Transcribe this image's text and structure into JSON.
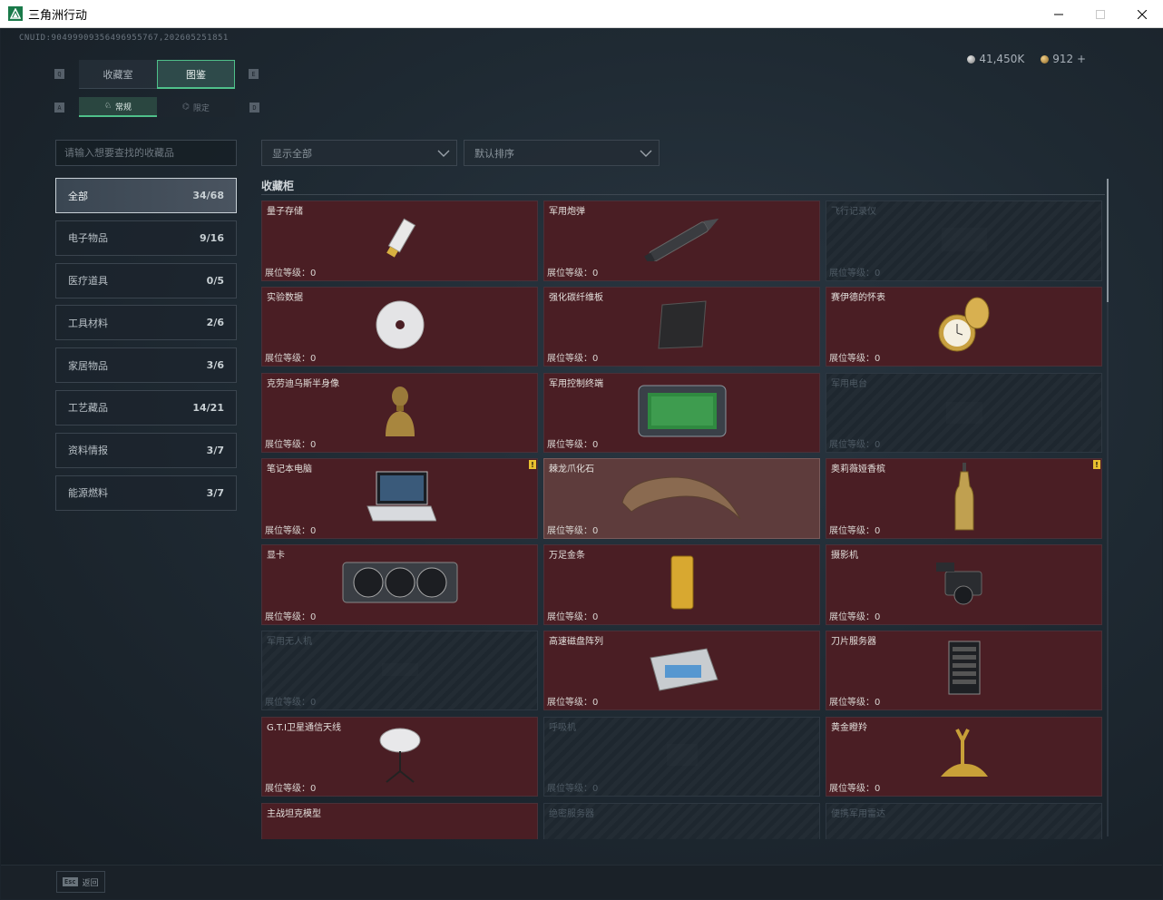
{
  "window": {
    "title": "三角洲行动",
    "controls": [
      "minimize",
      "maximize",
      "close"
    ]
  },
  "header": {
    "uid": "CNUID:9049990935649695576​7,202605251851",
    "currency_silver": "41,450K",
    "currency_gold": "912",
    "add_label": "+"
  },
  "tabs": {
    "main": [
      "收藏室",
      "图鉴"
    ],
    "main_active": 1,
    "sub": [
      "常规",
      "限定"
    ],
    "sub_active": 0,
    "key_q": "Q",
    "key_e": "E",
    "key_a": "A",
    "key_d": "D"
  },
  "search": {
    "placeholder": "请输入想要查找的收藏品"
  },
  "filters": {
    "show": "显示全部",
    "sort": "默认排序"
  },
  "categories": [
    {
      "label": "全部",
      "count": "34/68"
    },
    {
      "label": "电子物品",
      "count": "9/16"
    },
    {
      "label": "医疗道具",
      "count": "0/5"
    },
    {
      "label": "工具材料",
      "count": "2/6"
    },
    {
      "label": "家居物品",
      "count": "3/6"
    },
    {
      "label": "工艺藏品",
      "count": "14/21"
    },
    {
      "label": "资料情报",
      "count": "3/7"
    },
    {
      "label": "能源燃料",
      "count": "3/7"
    }
  ],
  "section_title": "收藏柜",
  "level_label": "展位等级：0",
  "items": [
    {
      "name": "量子存储",
      "state": "owned",
      "icon": "usb-drive-icon"
    },
    {
      "name": "军用炮弹",
      "state": "owned",
      "icon": "shell-icon"
    },
    {
      "name": "飞行记录仪",
      "state": "locked",
      "icon": "flight-recorder-icon"
    },
    {
      "name": "实验数据",
      "state": "owned",
      "icon": "cd-disc-icon"
    },
    {
      "name": "强化碳纤维板",
      "state": "owned",
      "icon": "carbon-plate-icon"
    },
    {
      "name": "赛伊德的怀表",
      "state": "owned",
      "icon": "pocket-watch-icon"
    },
    {
      "name": "克劳迪乌斯半身像",
      "state": "owned",
      "icon": "bust-icon"
    },
    {
      "name": "军用控制终端",
      "state": "owned",
      "icon": "terminal-icon"
    },
    {
      "name": "军用电台",
      "state": "locked",
      "icon": "radio-icon"
    },
    {
      "name": "笔记本电脑",
      "state": "owned",
      "icon": "laptop-icon",
      "warn": true
    },
    {
      "name": "棘龙爪化石",
      "state": "highlight",
      "icon": "claw-fossil-icon"
    },
    {
      "name": "奥莉薇娅香槟",
      "state": "owned",
      "icon": "champagne-icon",
      "warn": true
    },
    {
      "name": "显卡",
      "state": "owned",
      "icon": "gpu-icon"
    },
    {
      "name": "万足金条",
      "state": "owned",
      "icon": "gold-bar-icon"
    },
    {
      "name": "摄影机",
      "state": "owned",
      "icon": "camera-icon"
    },
    {
      "name": "军用无人机",
      "state": "locked",
      "icon": "drone-icon"
    },
    {
      "name": "高速磁盘阵列",
      "state": "owned",
      "icon": "disk-array-icon"
    },
    {
      "name": "刀片服务器",
      "state": "owned",
      "icon": "blade-server-icon"
    },
    {
      "name": "G.T.I卫星通信天线",
      "state": "owned",
      "icon": "satellite-dish-icon"
    },
    {
      "name": "呼吸机",
      "state": "locked",
      "icon": "ventilator-icon"
    },
    {
      "name": "黄金瞪羚",
      "state": "owned",
      "icon": "golden-gazelle-icon"
    },
    {
      "name": "主战坦克模型",
      "state": "owned",
      "icon": "tank-model-icon"
    },
    {
      "name": "绝密服务器",
      "state": "locked",
      "icon": "server-icon"
    },
    {
      "name": "便携军用雷达",
      "state": "locked",
      "icon": "radar-icon"
    }
  ],
  "warn_mark": "!",
  "footer": {
    "esc_key": "Esc",
    "esc_label": "返回"
  },
  "colors": {
    "accent": "#4fc08a",
    "owned_card": "#4a1e24",
    "locked_card": "#1e272f",
    "highlight_card": "#5e3c3c"
  }
}
